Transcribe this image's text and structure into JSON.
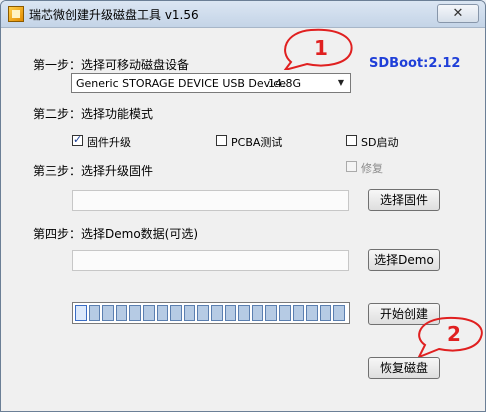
{
  "window": {
    "title": "瑞芯微创建升级磁盘工具 v1.56",
    "close_glyph": "✕"
  },
  "sdboot": "SDBoot:2.12",
  "step1": {
    "label": "第一步：选择可移动磁盘设备",
    "device": "Generic STORAGE DEVICE USB Device",
    "size": "14.8G",
    "arrow": "▼"
  },
  "step2": {
    "label": "第二步：选择功能模式",
    "options": [
      {
        "label": "固件升级",
        "checked": true,
        "disabled": false
      },
      {
        "label": "PCBA测试",
        "checked": false,
        "disabled": false
      },
      {
        "label": "SD启动",
        "checked": false,
        "disabled": false
      },
      {
        "label": "修复",
        "checked": false,
        "disabled": true
      }
    ],
    "check_glyph": "✓"
  },
  "step3": {
    "label": "第三步：选择升级固件",
    "button": "选择固件",
    "path": ""
  },
  "step4": {
    "label": "第四步：选择Demo数据(可选)",
    "button": "选择Demo",
    "path": ""
  },
  "progress": {
    "segments": 20,
    "filled": 0
  },
  "buttons": {
    "start": "开始创建",
    "restore": "恢复磁盘"
  },
  "callouts": [
    {
      "label": "1",
      "color": "#e02020"
    },
    {
      "label": "2",
      "color": "#e02020"
    }
  ]
}
